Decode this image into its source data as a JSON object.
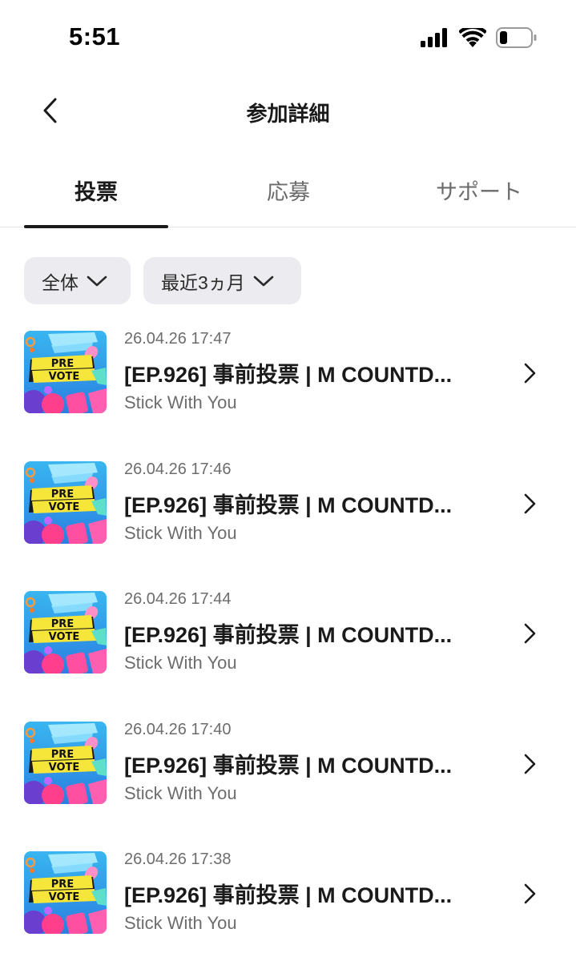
{
  "status_bar": {
    "time": "5:51",
    "icons": [
      "signal-icon",
      "wifi-icon",
      "battery-icon"
    ]
  },
  "header": {
    "title": "参加詳細",
    "back_icon": "chevron-left-icon"
  },
  "tabs": [
    {
      "label": "投票",
      "active": true
    },
    {
      "label": "応募",
      "active": false
    },
    {
      "label": "サポート",
      "active": false
    }
  ],
  "filters": [
    {
      "label": "全体",
      "icon": "chevron-down-icon"
    },
    {
      "label": "最近3ヵ月",
      "icon": "chevron-down-icon"
    }
  ],
  "thumbnail_text": {
    "line1": "PRE",
    "line2": "VOTE"
  },
  "items": [
    {
      "time": "26.04.26 17:47",
      "title": "[EP.926] 事前投票 | M COUNTD...",
      "subtitle": "Stick With You"
    },
    {
      "time": "26.04.26 17:46",
      "title": "[EP.926] 事前投票 | M COUNTD...",
      "subtitle": "Stick With You"
    },
    {
      "time": "26.04.26 17:44",
      "title": "[EP.926] 事前投票 | M COUNTD...",
      "subtitle": "Stick With You"
    },
    {
      "time": "26.04.26 17:40",
      "title": "[EP.926] 事前投票 | M COUNTD...",
      "subtitle": "Stick With You"
    },
    {
      "time": "26.04.26 17:38",
      "title": "[EP.926] 事前投票 | M COUNTD...",
      "subtitle": "Stick With You"
    }
  ],
  "colors": {
    "text_primary": "#1a1a1a",
    "text_secondary": "#6d6d6d",
    "chip_bg": "#ececf0",
    "thumb_bg": "#2ea8e8",
    "thumb_banner": "#f6e63a"
  }
}
